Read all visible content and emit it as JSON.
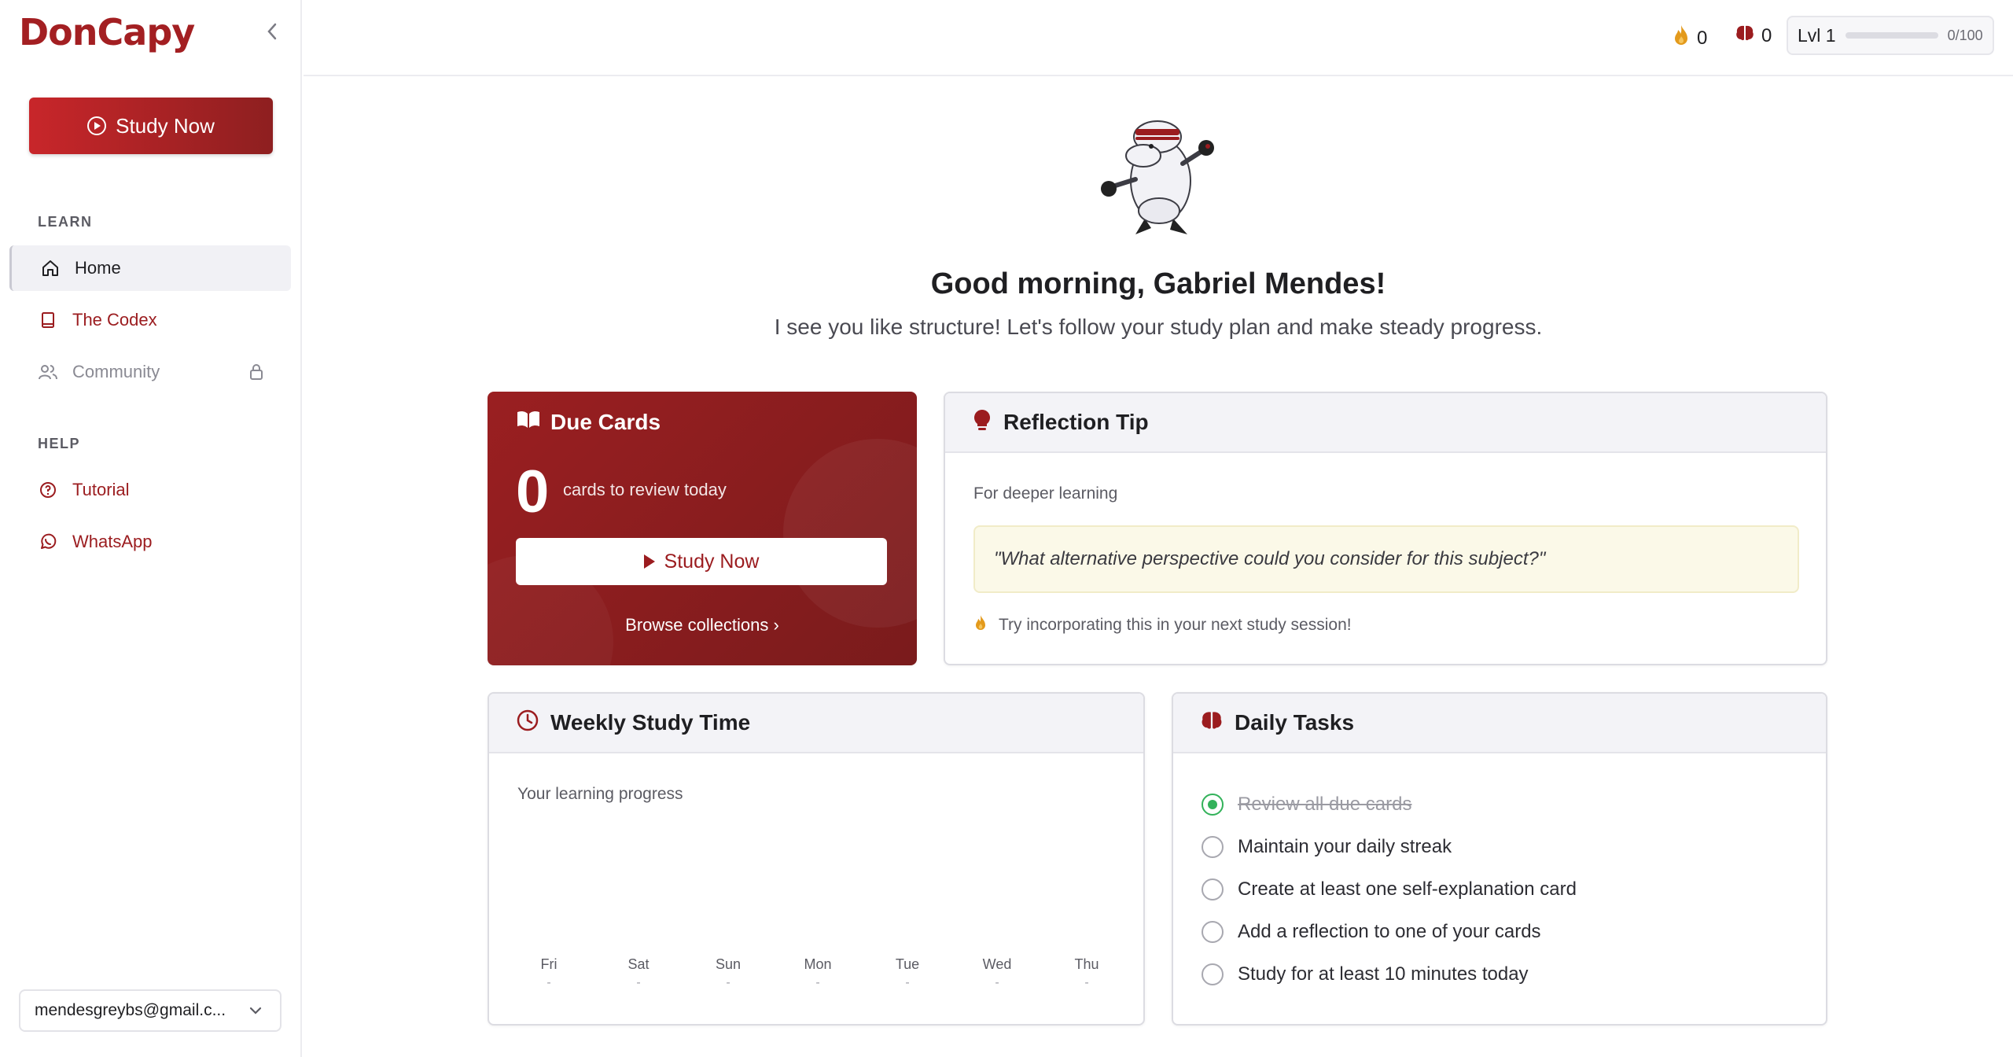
{
  "sidebar": {
    "logo": "DonCapy",
    "study_now": "Study Now",
    "learn_label": "LEARN",
    "help_label": "HELP",
    "nav": {
      "home": "Home",
      "codex": "The Codex",
      "community": "Community",
      "tutorial": "Tutorial",
      "whatsapp": "WhatsApp"
    },
    "account": "mendesgreybs@gmail.c..."
  },
  "topbar": {
    "streak": "0",
    "brain": "0",
    "level": "Lvl 1",
    "level_progress": "0/100",
    "level_fraction": 0
  },
  "greeting": {
    "title": "Good morning, Gabriel Mendes!",
    "subtitle": "I see you like structure! Let's follow your study plan and make steady progress."
  },
  "due_cards": {
    "title": "Due Cards",
    "count": "0",
    "count_label": "cards to review today",
    "button": "Study Now",
    "browse": "Browse collections ›"
  },
  "reflection": {
    "title": "Reflection Tip",
    "label": "For deeper learning",
    "quote": "\"What alternative perspective could you consider for this subject?\"",
    "tip": "Try incorporating this in your next study session!"
  },
  "weekly": {
    "title": "Weekly Study Time",
    "label": "Your learning progress",
    "days": [
      {
        "day": "Fri",
        "value": "-"
      },
      {
        "day": "Sat",
        "value": "-"
      },
      {
        "day": "Sun",
        "value": "-"
      },
      {
        "day": "Mon",
        "value": "-"
      },
      {
        "day": "Tue",
        "value": "-"
      },
      {
        "day": "Wed",
        "value": "-"
      },
      {
        "day": "Thu",
        "value": "-"
      }
    ]
  },
  "tasks": {
    "title": "Daily Tasks",
    "items": [
      {
        "label": "Review all due cards",
        "done": true
      },
      {
        "label": "Maintain your daily streak",
        "done": false
      },
      {
        "label": "Create at least one self-explanation card",
        "done": false
      },
      {
        "label": "Add a reflection to one of your cards",
        "done": false
      },
      {
        "label": "Study for at least 10 minutes today",
        "done": false
      }
    ]
  },
  "colors": {
    "brand": "#9b1c1f",
    "success": "#33b25a"
  }
}
